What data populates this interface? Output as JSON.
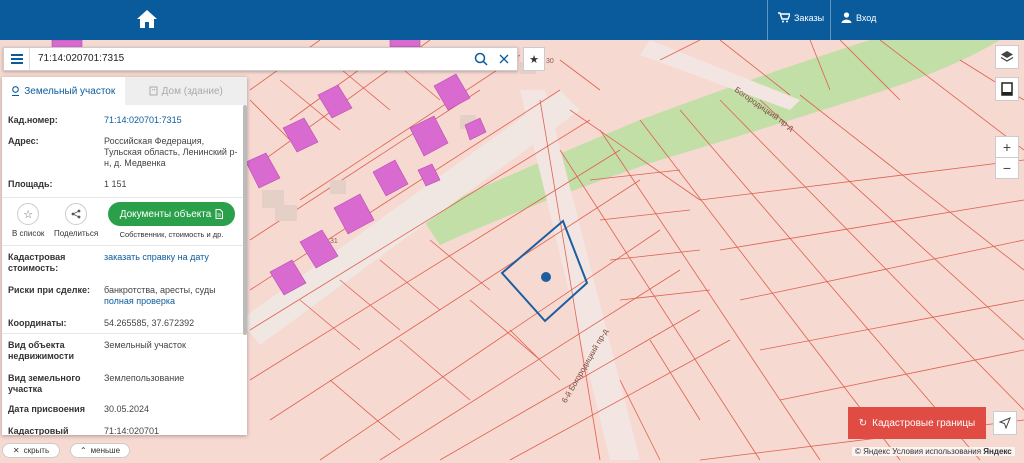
{
  "header": {
    "orders_label": "Заказы",
    "login_label": "Вход"
  },
  "search": {
    "value": "71:14:020701:7315"
  },
  "map": {
    "labels": [
      "30",
      "31"
    ],
    "road_label": "6-й Богородицкий пр-д",
    "road_label2": "Богородицкий пр-д"
  },
  "panel": {
    "tabs": [
      {
        "label": "Земельный участок",
        "active": true
      },
      {
        "label": "Дом (здание)",
        "active": false
      }
    ],
    "cad_number_label": "Кад.номер:",
    "cad_number_value": "71:14:020701:7315",
    "address_label": "Адрес:",
    "address_value": "Российская Федерация, Тульская область, Ленинский р-н, д. Медвенка",
    "area_label": "Площадь:",
    "area_value": "1 151",
    "actions": {
      "list_label": "В список",
      "share_label": "Поделиться",
      "docs_button": "Документы объекта",
      "docs_sub": "Собственник, стоимость и др."
    },
    "cad_cost_label": "Кадастровая стоимость:",
    "cad_cost_value": "заказать справку на дату",
    "risks_label": "Риски при сделке:",
    "risks_value": "банкротства, аресты, суды",
    "risks_link": "полная проверка",
    "coords_label": "Координаты:",
    "coords_value": "54.265585, 37.672392",
    "object_type_label": "Вид объекта недвижимости",
    "object_type_value": "Земельный участок",
    "land_type_label": "Вид земельного участка",
    "land_type_value": "Землепользование",
    "date_label": "Дата присвоения",
    "date_value": "30.05.2024",
    "cad_quarter_label": "Кадастровый",
    "cad_quarter_value": "71:14:020701"
  },
  "bottom": {
    "hide_label": "скрыть",
    "less_label": "меньше",
    "cad_borders_button": "Кадастровые границы",
    "yandex_text": "© Яндекс Условия использования",
    "yandex_logo": "Яндекс"
  },
  "colors": {
    "topbar": "#0a5b9c",
    "building": "#d86ad0",
    "parcel_border": "#e06050",
    "selected_parcel": "#1d5ea0",
    "green": "#2aa04a",
    "cad_button": "#e04b43"
  }
}
